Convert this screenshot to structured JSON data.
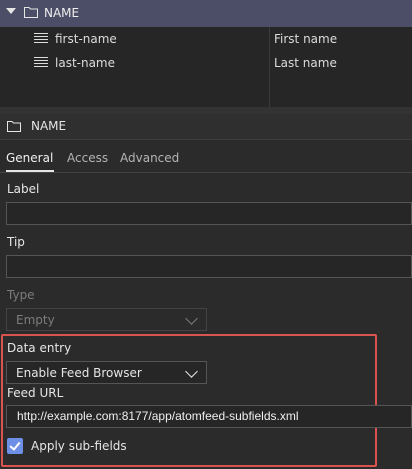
{
  "tree": {
    "root_label": "NAME",
    "rows": [
      {
        "name": "first-name",
        "label": "First name"
      },
      {
        "name": "last-name",
        "label": "Last name"
      }
    ]
  },
  "section": {
    "title": "NAME"
  },
  "tabs": [
    {
      "label": "General",
      "active": true
    },
    {
      "label": "Access",
      "active": false
    },
    {
      "label": "Advanced",
      "active": false
    }
  ],
  "form": {
    "label_caption": "Label",
    "label_value": "",
    "tip_caption": "Tip",
    "tip_value": "",
    "type_caption": "Type",
    "type_value": "Empty",
    "data_entry_caption": "Data entry",
    "data_entry_value": "Enable Feed Browser",
    "feed_url_caption": "Feed URL",
    "feed_url_value": "http://example.com:8177/app/atomfeed-subfields.xml",
    "apply_subfields_label": "Apply sub-fields",
    "apply_subfields_checked": true
  },
  "colors": {
    "highlight": "#d9534f",
    "checkbox": "#6d8fe6",
    "tree_header": "#4b4e66"
  }
}
